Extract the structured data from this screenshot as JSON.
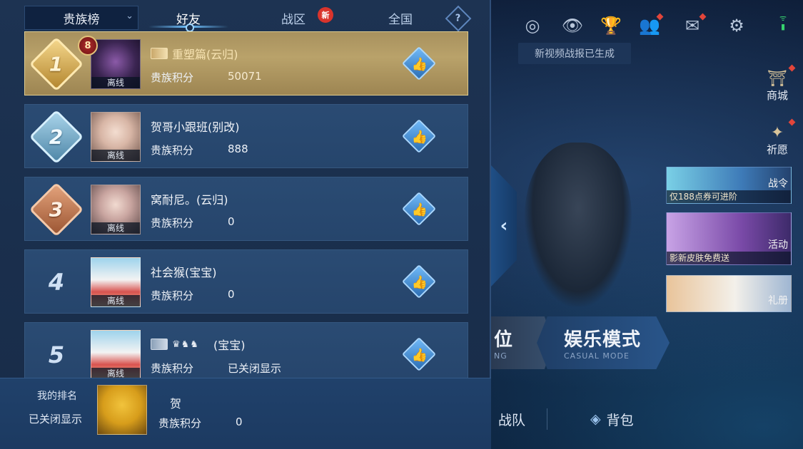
{
  "header": {
    "dropdown_label": "贵族榜",
    "tabs": [
      {
        "label": "好友",
        "active": true
      },
      {
        "label": "战区",
        "badge": "新"
      },
      {
        "label": "全国"
      }
    ],
    "help_glyph": "?"
  },
  "rows": [
    {
      "rank": "1",
      "medal": "gold",
      "name": "重塑篇(云归)",
      "score_label": "贵族积分",
      "score": "50071",
      "status": "离线",
      "level": "8",
      "noble_icon": true
    },
    {
      "rank": "2",
      "medal": "silver",
      "name": "贺哥小跟班(别改)",
      "score_label": "贵族积分",
      "score": "888",
      "status": "离线"
    },
    {
      "rank": "3",
      "medal": "bronze",
      "name": "窝耐尼。(云归)",
      "score_label": "贵族积分",
      "score": "0",
      "status": "离线"
    },
    {
      "rank": "4",
      "medal": "none",
      "name": "社会猴(宝宝)",
      "score_label": "贵族积分",
      "score": "0",
      "status": "离线"
    },
    {
      "rank": "5",
      "medal": "none",
      "name": "(宝宝)",
      "score_label": "贵族积分",
      "score": "已关闭显示",
      "status": "离线",
      "noble_icon": true,
      "crown_glyphs": "♛♞♞"
    }
  ],
  "my_rank": {
    "label": "我的排名",
    "rank_text": "已关闭显示",
    "name": "贺",
    "score_label": "贵族积分",
    "score": "0"
  },
  "right": {
    "notice": "新视频战报已生成",
    "top_icons": [
      "target-icon",
      "eye-icon",
      "trophy-icon",
      "friends-icon",
      "mail-icon",
      "gear-icon"
    ],
    "side_buttons": [
      {
        "label": "商城",
        "icon": "shop-icon"
      },
      {
        "label": "祈愿",
        "icon": "wish-icon"
      }
    ],
    "promos": [
      {
        "caption": "仅188点券可进阶",
        "tag": "战令"
      },
      {
        "caption": "影新皮肤免费送",
        "tag": "活动"
      },
      {
        "caption": "",
        "tag": "礼册"
      }
    ],
    "modes": {
      "rank_big": "位",
      "rank_small": "NG",
      "casual_big": "娱乐模式",
      "casual_small": "CASUAL MODE"
    },
    "bottom": [
      {
        "label": "战队",
        "icon": "team-icon"
      },
      {
        "label": "背包",
        "icon": "bag-icon"
      }
    ]
  },
  "colors": {
    "panel_bg": "#1d3352",
    "row_bg": "#2a4b73",
    "first_row_gold": "#b9a26a",
    "accent_blue": "#6fc1ff",
    "red_badge": "#d9342c"
  }
}
